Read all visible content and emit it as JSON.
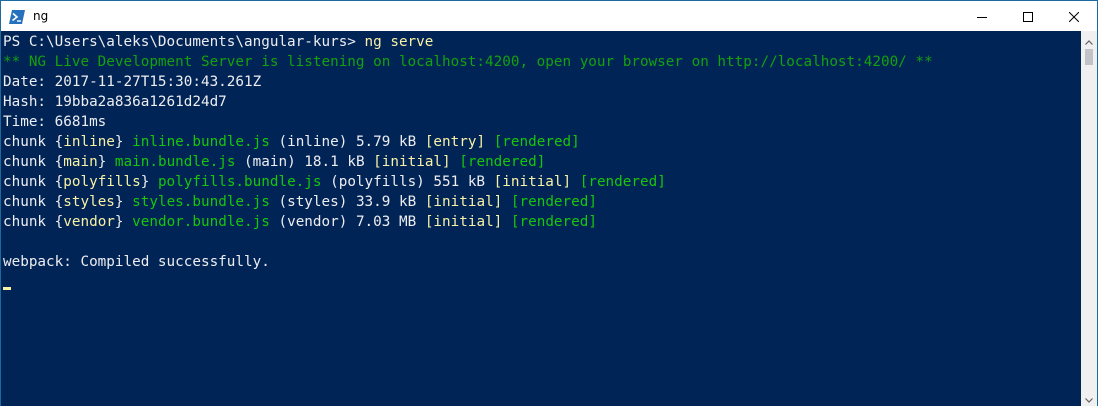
{
  "window": {
    "title": "ng"
  },
  "terminal": {
    "lines": [
      [
        {
          "t": "PS C:\\Users\\aleks\\Documents\\angular-kurs> ",
          "c": "white"
        },
        {
          "t": "ng serve",
          "c": "yellow"
        }
      ],
      [
        {
          "t": "** NG Live Development Server is listening on localhost:4200, open your browser on http://localhost:4200/ **",
          "c": "dkgreen"
        }
      ],
      [
        {
          "t": "Date: 2017-11-27T15:30:43.261Z",
          "c": "white"
        }
      ],
      [
        {
          "t": "Hash: 19bba2a836a1261d24d7",
          "c": "white"
        }
      ],
      [
        {
          "t": "Time: 6681ms",
          "c": "white"
        }
      ],
      [
        {
          "t": "chunk {",
          "c": "white"
        },
        {
          "t": "inline",
          "c": "yellow"
        },
        {
          "t": "} ",
          "c": "white"
        },
        {
          "t": "inline.bundle.js",
          "c": "green"
        },
        {
          "t": " (inline) 5.79 kB ",
          "c": "white"
        },
        {
          "t": "[entry]",
          "c": "yellow"
        },
        {
          "t": " ",
          "c": "white"
        },
        {
          "t": "[rendered]",
          "c": "green"
        }
      ],
      [
        {
          "t": "chunk {",
          "c": "white"
        },
        {
          "t": "main",
          "c": "yellow"
        },
        {
          "t": "} ",
          "c": "white"
        },
        {
          "t": "main.bundle.js",
          "c": "green"
        },
        {
          "t": " (main) 18.1 kB ",
          "c": "white"
        },
        {
          "t": "[initial]",
          "c": "yellow"
        },
        {
          "t": " ",
          "c": "white"
        },
        {
          "t": "[rendered]",
          "c": "green"
        }
      ],
      [
        {
          "t": "chunk {",
          "c": "white"
        },
        {
          "t": "polyfills",
          "c": "yellow"
        },
        {
          "t": "} ",
          "c": "white"
        },
        {
          "t": "polyfills.bundle.js",
          "c": "green"
        },
        {
          "t": " (polyfills) 551 kB ",
          "c": "white"
        },
        {
          "t": "[initial]",
          "c": "yellow"
        },
        {
          "t": " ",
          "c": "white"
        },
        {
          "t": "[rendered]",
          "c": "green"
        }
      ],
      [
        {
          "t": "chunk {",
          "c": "white"
        },
        {
          "t": "styles",
          "c": "yellow"
        },
        {
          "t": "} ",
          "c": "white"
        },
        {
          "t": "styles.bundle.js",
          "c": "green"
        },
        {
          "t": " (styles) 33.9 kB ",
          "c": "white"
        },
        {
          "t": "[initial]",
          "c": "yellow"
        },
        {
          "t": " ",
          "c": "white"
        },
        {
          "t": "[rendered]",
          "c": "green"
        }
      ],
      [
        {
          "t": "chunk {",
          "c": "white"
        },
        {
          "t": "vendor",
          "c": "yellow"
        },
        {
          "t": "} ",
          "c": "white"
        },
        {
          "t": "vendor.bundle.js",
          "c": "green"
        },
        {
          "t": " (vendor) 7.03 MB ",
          "c": "white"
        },
        {
          "t": "[initial]",
          "c": "yellow"
        },
        {
          "t": " ",
          "c": "white"
        },
        {
          "t": "[rendered]",
          "c": "green"
        }
      ],
      [],
      [
        {
          "t": "webpack: Compiled successfully.",
          "c": "white"
        }
      ]
    ]
  },
  "icons": {
    "app": "powershell-icon",
    "minimize": "minimize-icon",
    "maximize": "maximize-icon",
    "close": "close-icon",
    "scroll_up": "chevron-up-icon",
    "scroll_down": "chevron-down-icon"
  },
  "colors": {
    "background": "#012456",
    "white": "#eeedf0",
    "yellow": "#f9f1a5",
    "green": "#16c60c",
    "dkgreen": "#13a10e",
    "cursor": "#f9f1a5"
  }
}
